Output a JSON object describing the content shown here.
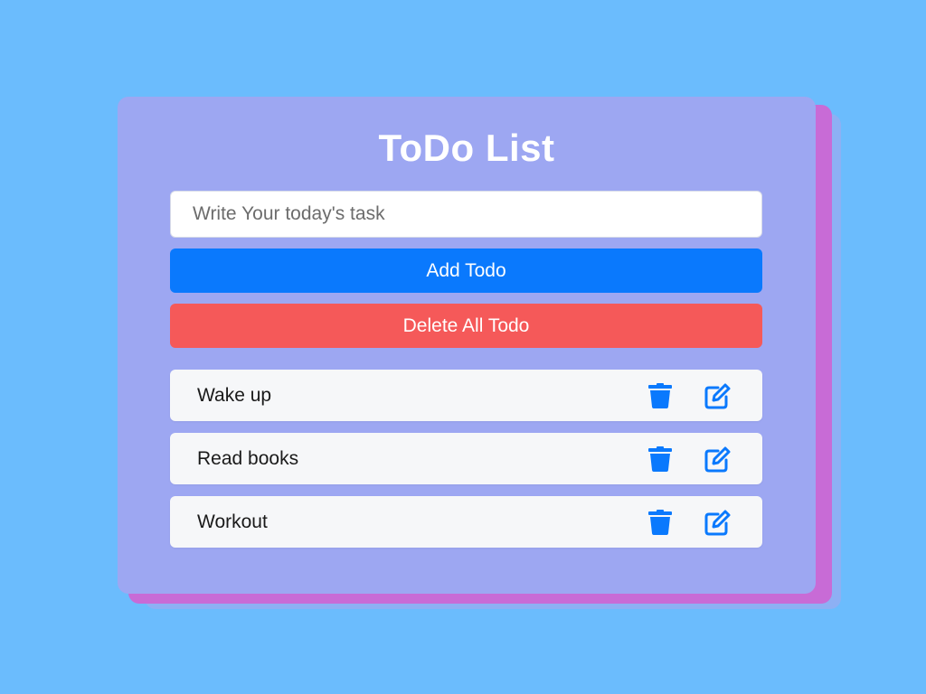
{
  "app": {
    "title": "ToDo List"
  },
  "form": {
    "input_placeholder": "Write Your today's task",
    "input_value": "",
    "add_label": "Add Todo",
    "delete_all_label": "Delete All Todo"
  },
  "todos": [
    {
      "text": "Wake up",
      "actions": [
        "trash-icon",
        "edit-icon"
      ]
    },
    {
      "text": "Read books",
      "actions": [
        "trash-icon",
        "edit-icon"
      ]
    },
    {
      "text": "Workout",
      "actions": [
        "trash-icon",
        "edit-icon"
      ]
    }
  ],
  "colors": {
    "page_background": "#6bbcfd",
    "card_background": "#9da7f2",
    "card_shadow": "#c86bd6",
    "primary": "#0a79fd",
    "danger": "#f55959",
    "icon": "#0a79fd",
    "todo_background": "#f6f7f9"
  }
}
